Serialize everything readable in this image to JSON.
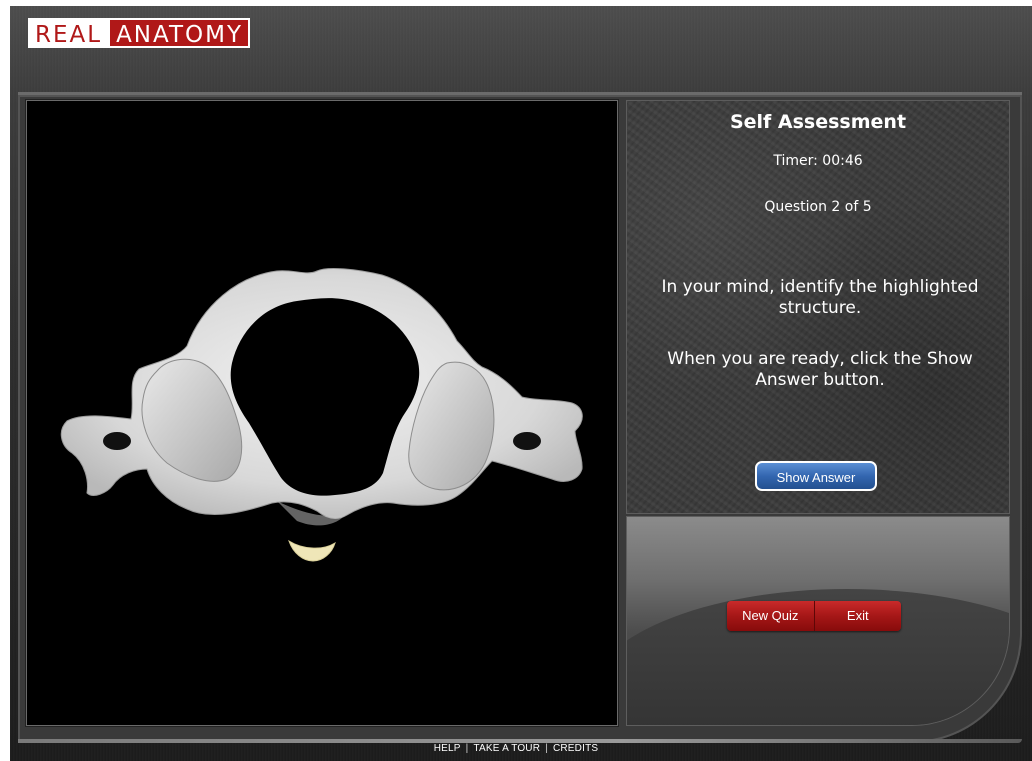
{
  "logo": {
    "part1": "REAL",
    "part2": "ANATOMY"
  },
  "viewer": {
    "structure_highlight_color": "#efe6b8",
    "bone_color": "#e2e2e2"
  },
  "self_assessment": {
    "title": "Self Assessment",
    "timer": "Timer: 00:46",
    "question": "Question 2 of 5",
    "instruction": "In your mind, identify the highlighted structure.",
    "instruction2": "When you are ready, click the Show Answer button.",
    "show_answer_label": "Show Answer",
    "button_color": "#3366b0"
  },
  "quiz_controls": {
    "new_quiz_label": "New Quiz",
    "exit_label": "Exit",
    "button_color": "#a51717"
  },
  "footer": {
    "help": "HELP",
    "tour": "TAKE A TOUR",
    "credits": "CREDITS",
    "separator": "|"
  }
}
